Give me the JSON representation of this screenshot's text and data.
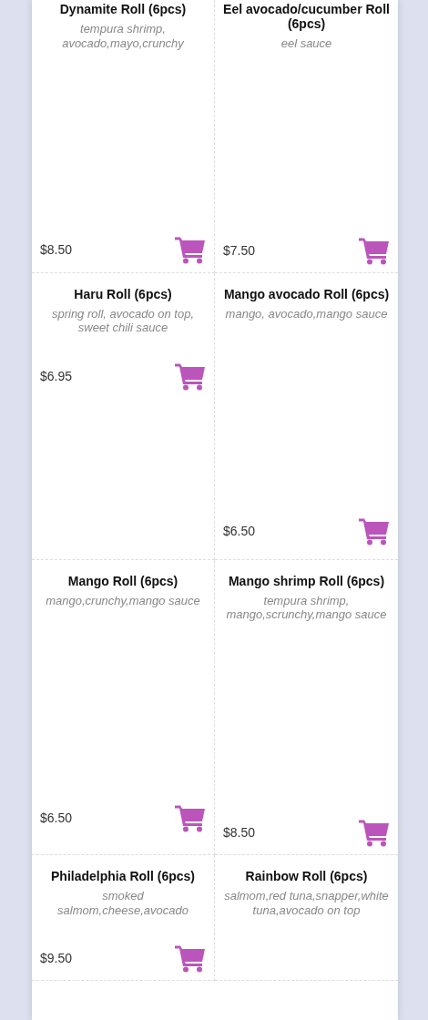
{
  "menu_items": [
    {
      "name": "Dynamite Roll (6pcs)",
      "description": "tempura shrimp, avocado,mayo,crunchy",
      "price": "$8.50"
    },
    {
      "name": "Eel avocado/cucumber Roll (6pcs)",
      "description": "eel sauce",
      "price": "$7.50"
    },
    {
      "name": "Haru Roll (6pcs)",
      "description": "spring roll, avocado on top, sweet chili sauce",
      "price": "$6.95"
    },
    {
      "name": "Mango avocado Roll (6pcs)",
      "description": "mango, avocado,mango sauce",
      "price": "$6.50"
    },
    {
      "name": "Mango Roll (6pcs)",
      "description": "mango,crunchy,mango sauce",
      "price": "$6.50"
    },
    {
      "name": "Mango shrimp Roll (6pcs)",
      "description": "tempura shrimp, mango,scrunchy,mango sauce",
      "price": "$8.50"
    },
    {
      "name": "Philadelphia Roll (6pcs)",
      "description": "smoked salmom,cheese,avocado",
      "price": "$9.50"
    },
    {
      "name": "Rainbow Roll (6pcs)",
      "description": "salmom,red tuna,snapper,white tuna,avocado on top"
    }
  ]
}
